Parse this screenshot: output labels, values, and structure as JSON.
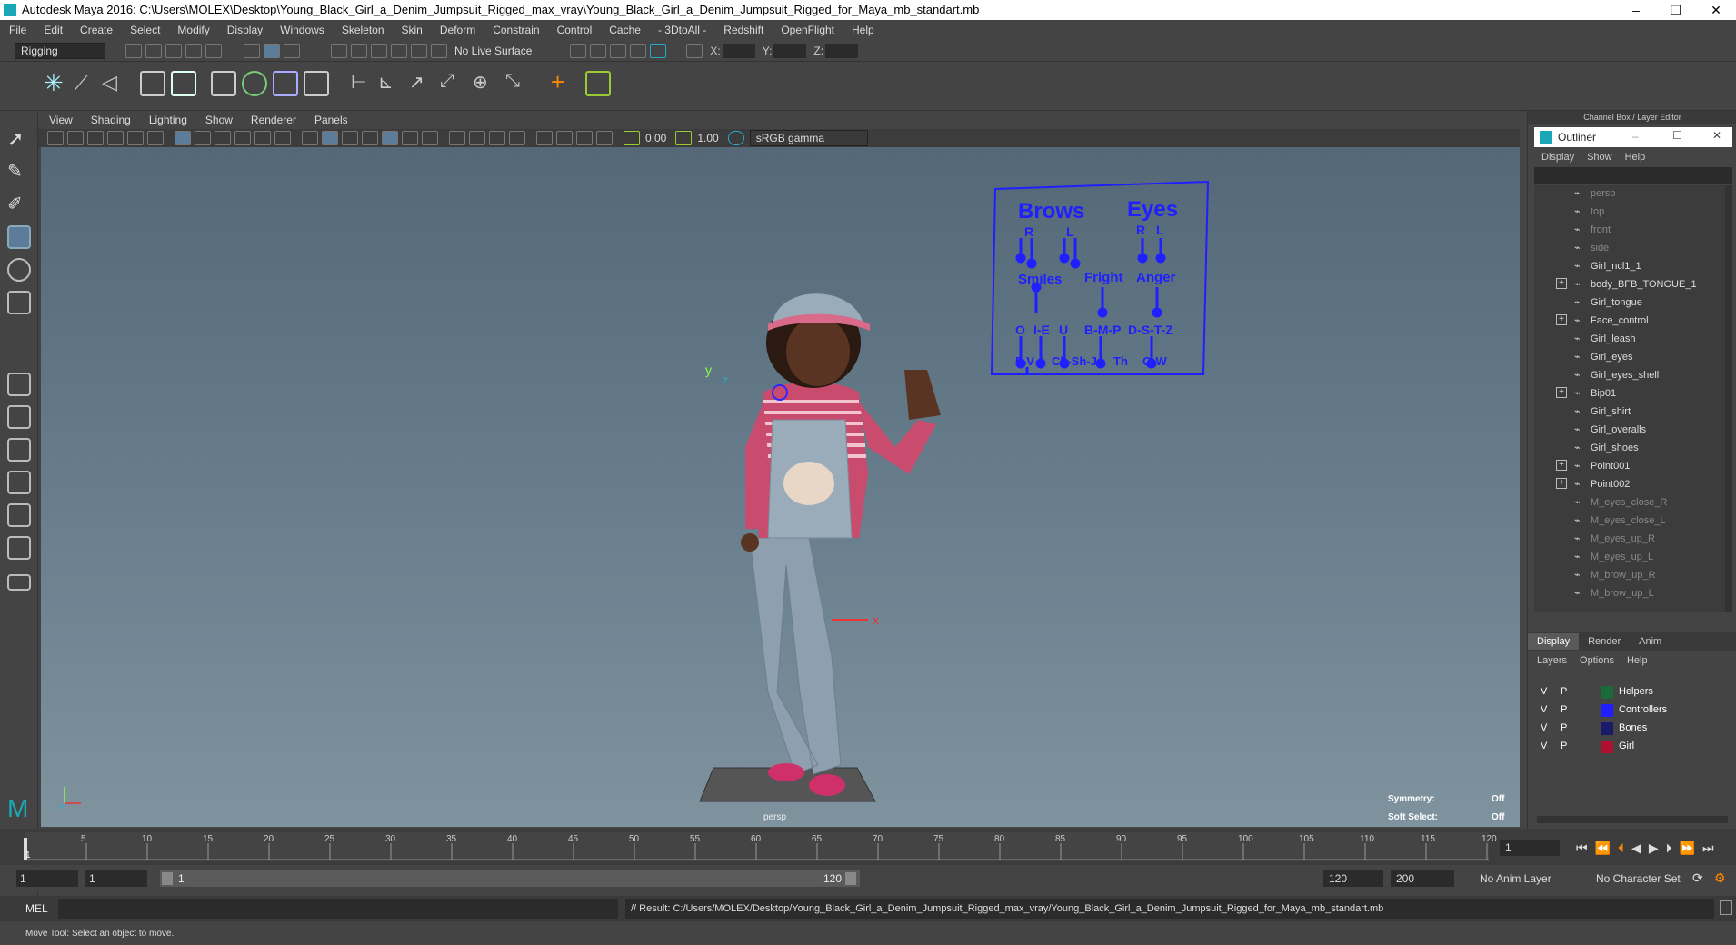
{
  "title_bar": {
    "title": "Autodesk Maya 2016: C:\\Users\\MOLEX\\Desktop\\Young_Black_Girl_a_Denim_Jumpsuit_Rigged_max_vray\\Young_Black_Girl_a_Denim_Jumpsuit_Rigged_for_Maya_mb_standart.mb",
    "minimize": "–",
    "restore": "❐",
    "close": "✕"
  },
  "menu": [
    "File",
    "Edit",
    "Create",
    "Select",
    "Modify",
    "Display",
    "Windows",
    "Skeleton",
    "Skin",
    "Deform",
    "Constrain",
    "Control",
    "Cache",
    "- 3DtoAll -",
    "Redshift",
    "OpenFlight",
    "Help"
  ],
  "toolbar": {
    "mode": "Rigging",
    "live_surface": "No Live Surface",
    "x_label": "X:",
    "y_label": "Y:",
    "z_label": "Z:"
  },
  "panel_menu": [
    "View",
    "Shading",
    "Lighting",
    "Show",
    "Renderer",
    "Panels"
  ],
  "panel_tools": {
    "exposure": "0.00",
    "gamma": "1.00",
    "color_space": "sRGB gamma"
  },
  "viewport": {
    "camera": "persp",
    "symmetry_label": "Symmetry:",
    "symmetry_value": "Off",
    "soft_select_label": "Soft Select:",
    "soft_select_value": "Off",
    "axis_x": "x",
    "axis_y": "y",
    "axis_z": "z"
  },
  "face_controls": {
    "brows": "Brows",
    "eyes": "Eyes",
    "r": "R",
    "l": "L",
    "smiles": "Smiles",
    "fright": "Fright",
    "anger": "Anger",
    "o": "O",
    "i_e": "I-E",
    "u": "U",
    "bmp": "B-M-P",
    "dstz": "D-S-T-Z",
    "fv": "F-V",
    "chshj": "Ch-Sh-J",
    "th": "Th",
    "qw": "Q-W"
  },
  "right_panel": {
    "header": "Channel Box / Layer Editor",
    "outliner_title": "Outliner",
    "outliner_menu": [
      "Display",
      "Show",
      "Help"
    ],
    "items": [
      {
        "label": "persp",
        "dim": true,
        "expand": false
      },
      {
        "label": "top",
        "dim": true,
        "expand": false
      },
      {
        "label": "front",
        "dim": true,
        "expand": false
      },
      {
        "label": "side",
        "dim": true,
        "expand": false
      },
      {
        "label": "Girl_ncl1_1",
        "dim": false,
        "expand": false
      },
      {
        "label": "body_BFB_TONGUE_1",
        "dim": false,
        "expand": true
      },
      {
        "label": "Girl_tongue",
        "dim": false,
        "expand": false
      },
      {
        "label": "Face_control",
        "dim": false,
        "expand": true
      },
      {
        "label": "Girl_leash",
        "dim": false,
        "expand": false
      },
      {
        "label": "Girl_eyes",
        "dim": false,
        "expand": false
      },
      {
        "label": "Girl_eyes_shell",
        "dim": false,
        "expand": false
      },
      {
        "label": "Bip01",
        "dim": false,
        "expand": true
      },
      {
        "label": "Girl_shirt",
        "dim": false,
        "expand": false
      },
      {
        "label": "Girl_overalls",
        "dim": false,
        "expand": false
      },
      {
        "label": "Girl_shoes",
        "dim": false,
        "expand": false
      },
      {
        "label": "Point001",
        "dim": false,
        "expand": true
      },
      {
        "label": "Point002",
        "dim": false,
        "expand": true
      },
      {
        "label": "M_eyes_close_R",
        "dim": true,
        "expand": false
      },
      {
        "label": "M_eyes_close_L",
        "dim": true,
        "expand": false
      },
      {
        "label": "M_eyes_up_R",
        "dim": true,
        "expand": false
      },
      {
        "label": "M_eyes_up_L",
        "dim": true,
        "expand": false
      },
      {
        "label": "M_brow_up_R",
        "dim": true,
        "expand": false
      },
      {
        "label": "M_brow_up_L",
        "dim": true,
        "expand": false
      }
    ],
    "tabs": [
      "Display",
      "Render",
      "Anim"
    ],
    "layer_menu": [
      "Layers",
      "Options",
      "Help"
    ],
    "layers": [
      {
        "v": "V",
        "p": "P",
        "name": "Helpers",
        "color": "#1a6a3a"
      },
      {
        "v": "V",
        "p": "P",
        "name": "Controllers",
        "color": "#1f1fff"
      },
      {
        "v": "V",
        "p": "P",
        "name": "Bones",
        "color": "#1a1a6a"
      },
      {
        "v": "V",
        "p": "P",
        "name": "Girl",
        "color": "#b01030"
      }
    ]
  },
  "timeline": {
    "ticks": [
      "5",
      "10",
      "15",
      "20",
      "25",
      "30",
      "35",
      "40",
      "45",
      "50",
      "55",
      "60",
      "65",
      "70",
      "75",
      "80",
      "85",
      "90",
      "95",
      "100",
      "105",
      "110",
      "115",
      "120"
    ],
    "current": "1",
    "frame_field": "1"
  },
  "range": {
    "start": "1",
    "start2": "1",
    "slider_start": "1",
    "slider_end": "120",
    "end": "120",
    "end2": "200",
    "anim_layer": "No Anim Layer",
    "char_set": "No Character Set"
  },
  "cmd": {
    "label": "MEL",
    "result": "// Result: C:/Users/MOLEX/Desktop/Young_Black_Girl_a_Denim_Jumpsuit_Rigged_max_vray/Young_Black_Girl_a_Denim_Jumpsuit_Rigged_for_Maya_mb_standart.mb"
  },
  "help_line": "Move Tool: Select an object to move."
}
